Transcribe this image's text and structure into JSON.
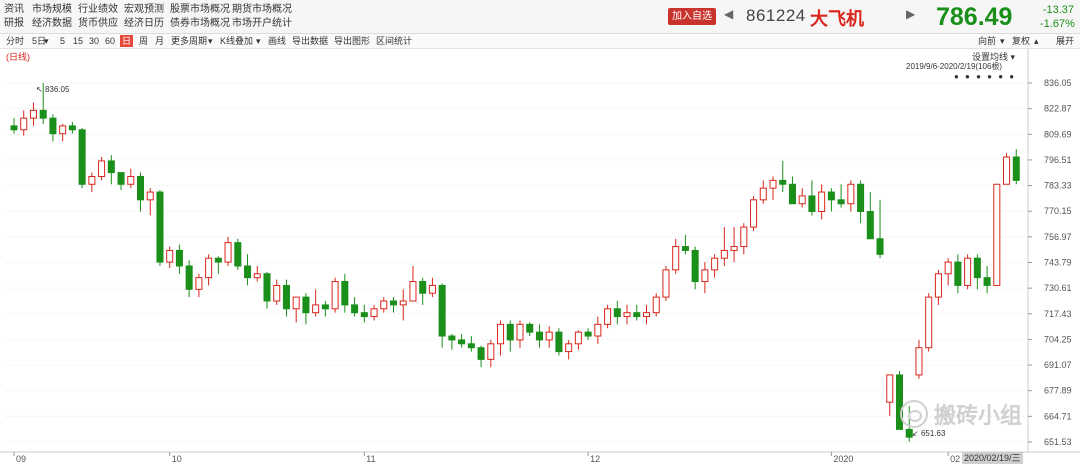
{
  "nav": {
    "col1": [
      "资讯",
      "研报"
    ],
    "col2": [
      "市场规模",
      "经济数据"
    ],
    "col3": [
      "行业绩效",
      "货币供应"
    ],
    "col4": [
      "宏观预测",
      "经济日历"
    ],
    "col5": [
      "股票市场概况",
      "债券市场概况"
    ],
    "col6": [
      "期货市场概况",
      "市场开户统计"
    ]
  },
  "quote": {
    "add_fav": "加入自选",
    "code": "861224",
    "name": "大飞机",
    "price": "786.49",
    "change": "-13.37",
    "change_pct": "-1.67%",
    "up_color": "#d9261c",
    "down_color": "#1a8f1a"
  },
  "toolbar": {
    "items": [
      "分时",
      "5日",
      "5",
      "15",
      "30",
      "60",
      "日",
      "周",
      "月",
      "更多周期",
      "K线叠加",
      "画线",
      "导出数据",
      "导出图形",
      "区间统计"
    ],
    "active": "日",
    "right_items": [
      "向前",
      "复权",
      "展开"
    ]
  },
  "chart": {
    "period_label": "(日线)",
    "ma_label": "设置均线",
    "range_label": "2019/9/6-2020/2/19(106根)",
    "ma_dots": "● ● ● ● ● ●",
    "high_annotation": "836.05",
    "low_annotation": "651.63",
    "date_tag": "2020/02/19/三",
    "watermark": "搬砖小组"
  },
  "chart_data": {
    "type": "candlestick",
    "y_ticks": [
      "836.05",
      "822.87",
      "809.69",
      "796.51",
      "783.33",
      "770.15",
      "756.97",
      "743.79",
      "730.61",
      "717.43",
      "704.25",
      "691.07",
      "677.89",
      "664.71",
      "651.53"
    ],
    "ylim": [
      651.53,
      836.05
    ],
    "x_months": [
      "09",
      "10",
      "11",
      "12",
      "2020",
      "02"
    ],
    "candles": [
      [
        814,
        818,
        810,
        812
      ],
      [
        812,
        822,
        809,
        818
      ],
      [
        818,
        826,
        814,
        822
      ],
      [
        822,
        836.05,
        815,
        818
      ],
      [
        818,
        820,
        806,
        810
      ],
      [
        810,
        815,
        806,
        814
      ],
      [
        814,
        816,
        810,
        812
      ],
      [
        812,
        813,
        782,
        784
      ],
      [
        784,
        790,
        780,
        788
      ],
      [
        788,
        798,
        786,
        796
      ],
      [
        796,
        799,
        784,
        790
      ],
      [
        790,
        790,
        781,
        784
      ],
      [
        784,
        792,
        782,
        788
      ],
      [
        788,
        790,
        770,
        776
      ],
      [
        776,
        782,
        768,
        780
      ],
      [
        780,
        781,
        742,
        744
      ],
      [
        744,
        752,
        741,
        750
      ],
      [
        750,
        753,
        738,
        742
      ],
      [
        742,
        745,
        726,
        730
      ],
      [
        730,
        738,
        726,
        736
      ],
      [
        736,
        748,
        732,
        746
      ],
      [
        746,
        747,
        738,
        744
      ],
      [
        744,
        757,
        742,
        754
      ],
      [
        754,
        756,
        740,
        742
      ],
      [
        742,
        748,
        732,
        736
      ],
      [
        736,
        742,
        734,
        738
      ],
      [
        738,
        739,
        720,
        724
      ],
      [
        724,
        735,
        722,
        732
      ],
      [
        732,
        735,
        716,
        720
      ],
      [
        720,
        724,
        713,
        726
      ],
      [
        726,
        728,
        712,
        718
      ],
      [
        718,
        730,
        716,
        722
      ],
      [
        722,
        724,
        716,
        720
      ],
      [
        720,
        736,
        718,
        734
      ],
      [
        734,
        738,
        718,
        722
      ],
      [
        722,
        726,
        716,
        718
      ],
      [
        718,
        722,
        713,
        716
      ],
      [
        716,
        722,
        714,
        720
      ],
      [
        720,
        726,
        718,
        724
      ],
      [
        724,
        726,
        718,
        722
      ],
      [
        722,
        730,
        714,
        724
      ],
      [
        724,
        742,
        728,
        734
      ],
      [
        734,
        736,
        722,
        728
      ],
      [
        728,
        736,
        726,
        732
      ],
      [
        732,
        733,
        700,
        706
      ],
      [
        706,
        707,
        699,
        704
      ],
      [
        704,
        707,
        700,
        702
      ],
      [
        702,
        706,
        698,
        700
      ],
      [
        700,
        701,
        690,
        694
      ],
      [
        694,
        704,
        690,
        702
      ],
      [
        702,
        714,
        696,
        712
      ],
      [
        712,
        714,
        698,
        704
      ],
      [
        704,
        714,
        700,
        712
      ],
      [
        712,
        713,
        706,
        708
      ],
      [
        708,
        712,
        700,
        704
      ],
      [
        704,
        711,
        700,
        708
      ],
      [
        708,
        710,
        696,
        698
      ],
      [
        698,
        704,
        694,
        702
      ],
      [
        702,
        709,
        699,
        708
      ],
      [
        708,
        710,
        704,
        706
      ],
      [
        706,
        716,
        702,
        712
      ],
      [
        712,
        722,
        710,
        720
      ],
      [
        720,
        724,
        712,
        716
      ],
      [
        716,
        722,
        712,
        718
      ],
      [
        718,
        722,
        714,
        716
      ],
      [
        716,
        722,
        712,
        718
      ],
      [
        718,
        728,
        716,
        726
      ],
      [
        726,
        742,
        724,
        740
      ],
      [
        740,
        756,
        738,
        752
      ],
      [
        752,
        758,
        748,
        750
      ],
      [
        750,
        752,
        730,
        734
      ],
      [
        734,
        744,
        728,
        740
      ],
      [
        740,
        748,
        736,
        746
      ],
      [
        746,
        762,
        742,
        750
      ],
      [
        750,
        762,
        744,
        752
      ],
      [
        752,
        764,
        748,
        762
      ],
      [
        762,
        778,
        760,
        776
      ],
      [
        776,
        786,
        774,
        782
      ],
      [
        782,
        788,
        776,
        786
      ],
      [
        786,
        796,
        780,
        784
      ],
      [
        784,
        788,
        778,
        774
      ],
      [
        774,
        782,
        772,
        778
      ],
      [
        778,
        786,
        768,
        770
      ],
      [
        770,
        784,
        766,
        780
      ],
      [
        780,
        782,
        770,
        776
      ],
      [
        776,
        784,
        772,
        774
      ],
      [
        774,
        786,
        770,
        784
      ],
      [
        784,
        786,
        764,
        770
      ],
      [
        770,
        780,
        756,
        756
      ],
      [
        756,
        776,
        746,
        748
      ],
      [
        672,
        686,
        665,
        686
      ],
      [
        686,
        688,
        660,
        658
      ],
      [
        658,
        670,
        651.63,
        654
      ],
      [
        686,
        704,
        684,
        700
      ],
      [
        700,
        728,
        698,
        726
      ],
      [
        726,
        740,
        722,
        738
      ],
      [
        738,
        746,
        732,
        744
      ],
      [
        744,
        748,
        728,
        732
      ],
      [
        732,
        748,
        730,
        746
      ],
      [
        746,
        748,
        730,
        736
      ],
      [
        736,
        742,
        728,
        732
      ],
      [
        732,
        780,
        732,
        784
      ],
      [
        784,
        800,
        786,
        798
      ],
      [
        798,
        802,
        784,
        786
      ]
    ]
  }
}
